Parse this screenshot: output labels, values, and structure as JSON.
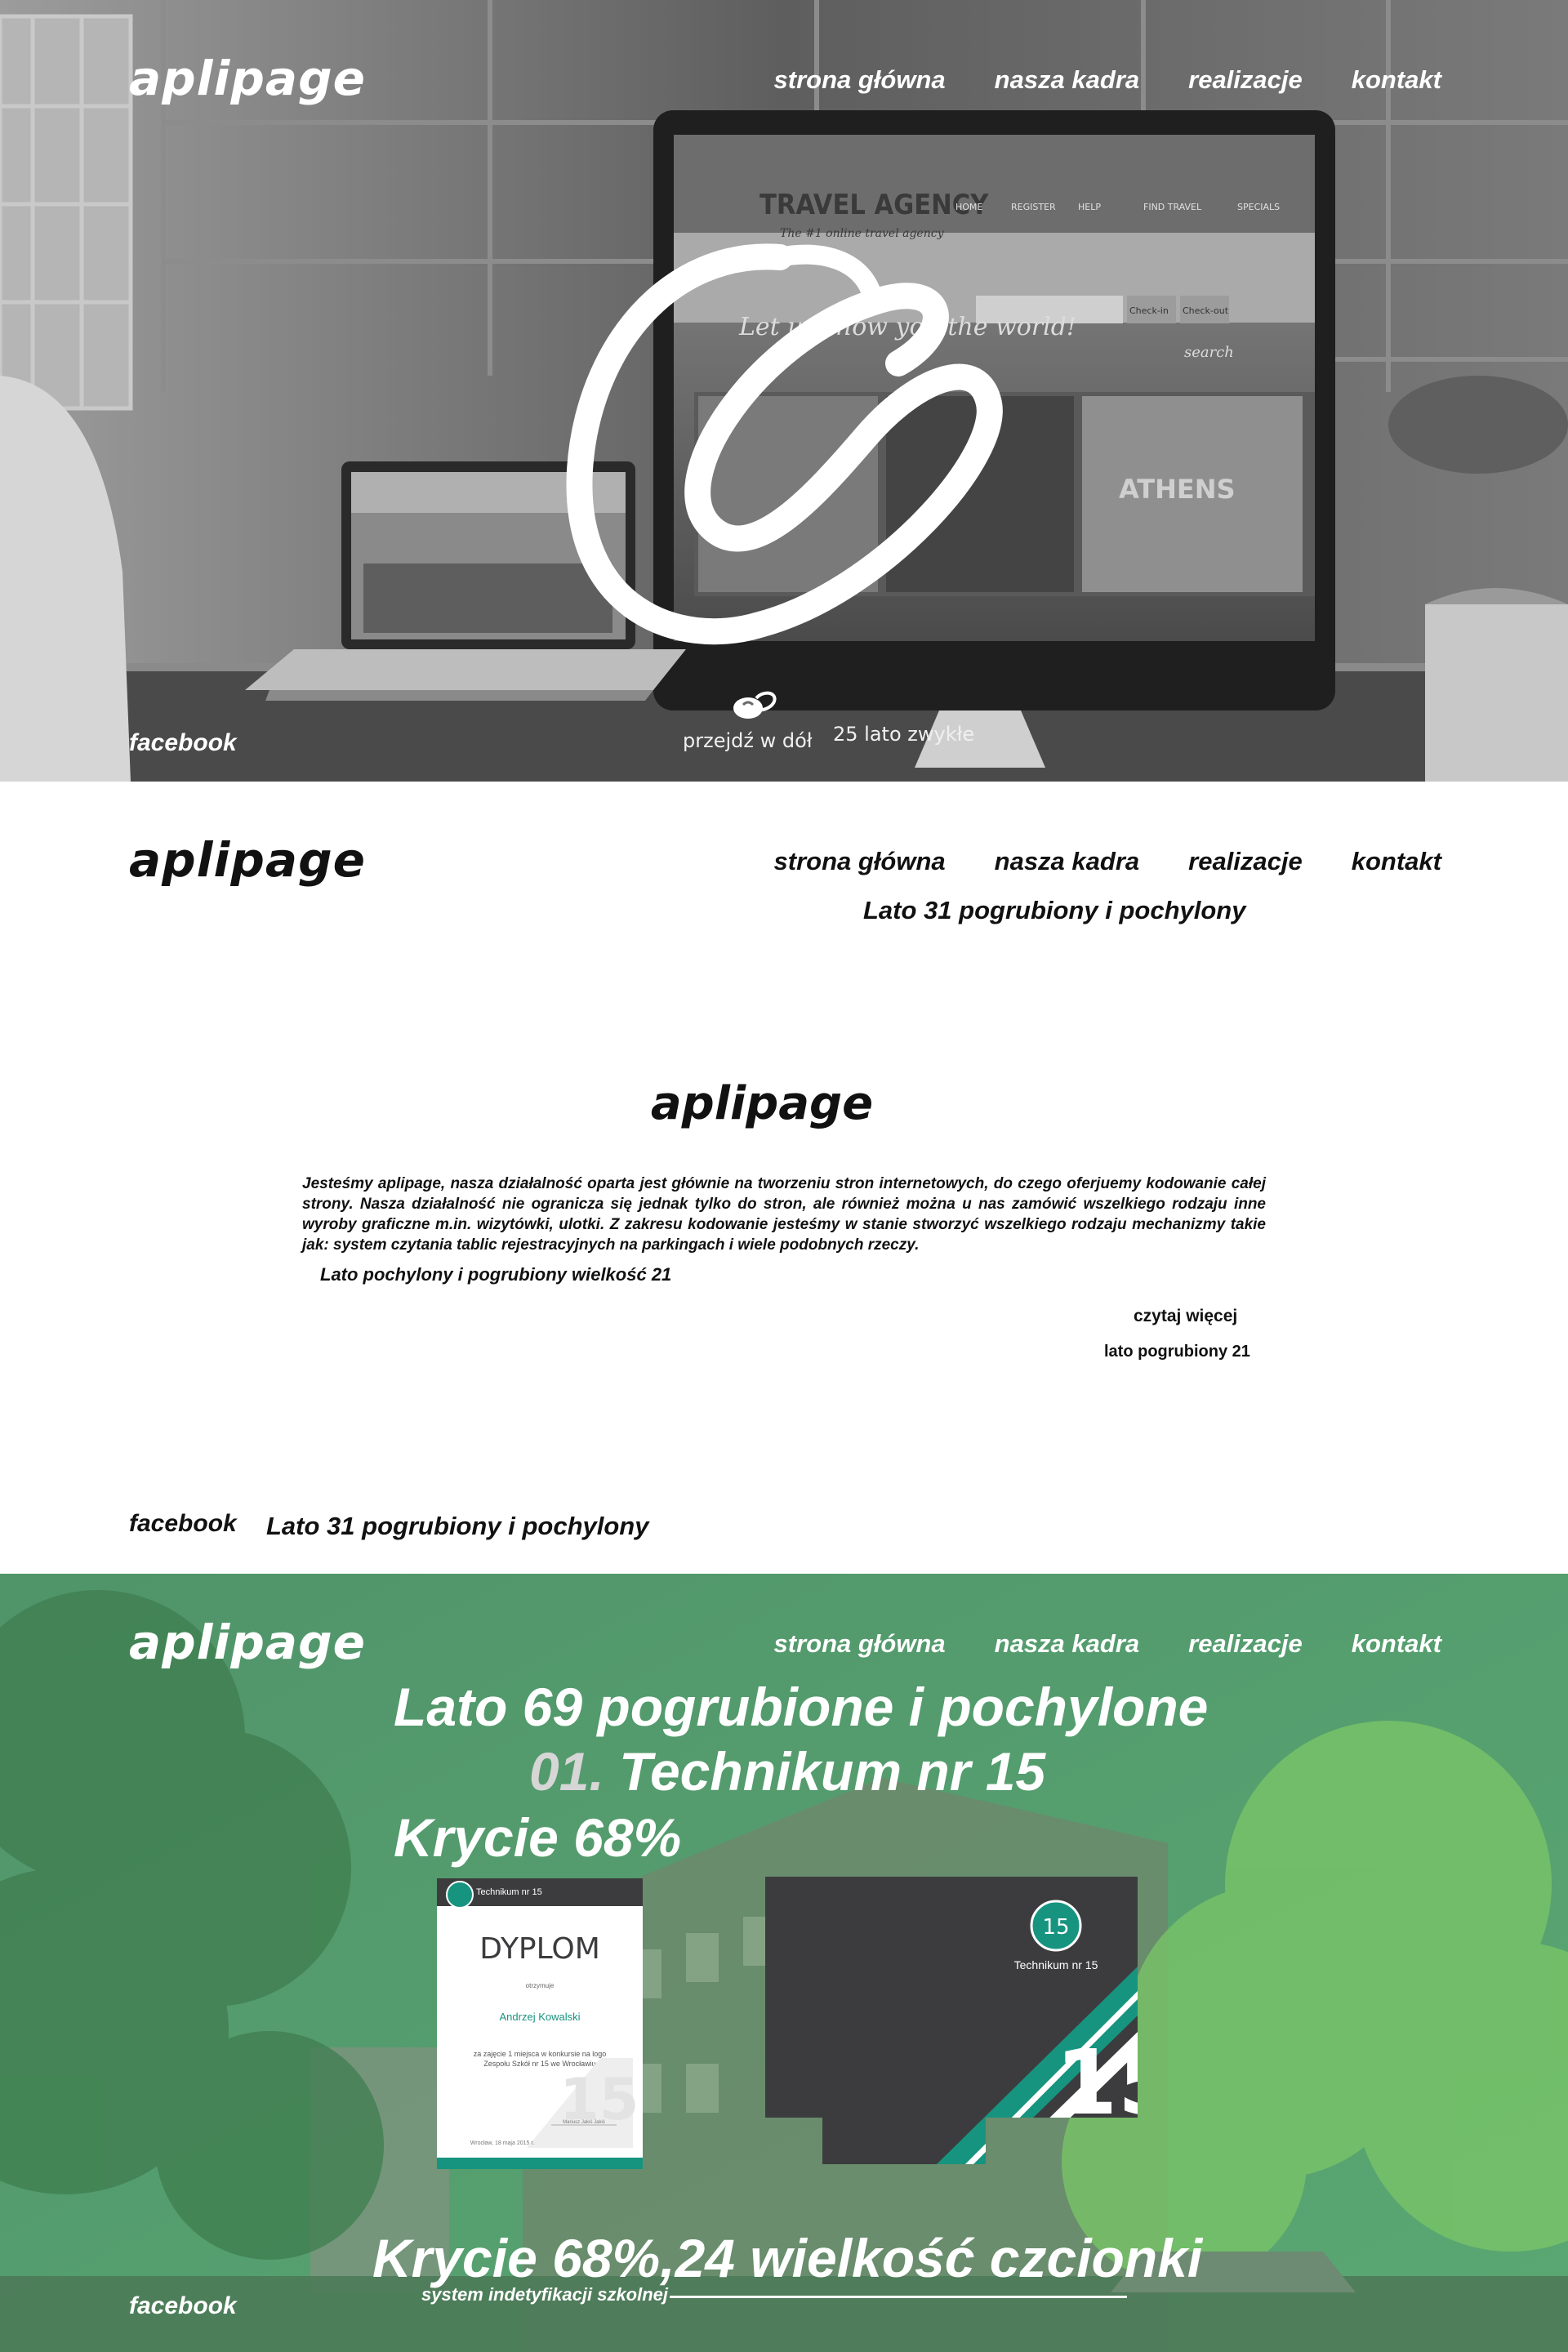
{
  "hero": {
    "logo": "aplipage",
    "nav": [
      "strona główna",
      "nasza kadra",
      "realizacje",
      "kontakt"
    ],
    "facebook": "facebook",
    "scroll_label": "przejdź w dół",
    "scroll_note": "25 lato zwykłe",
    "screen_texts": {
      "agency": "TRAVEL AGENCY",
      "agency_sub": "The #1 online travel agency",
      "slogan": "Let us show you the world!",
      "city": "ATHENS",
      "search": "search",
      "checkin": "Check-in",
      "checkout": "Check-out",
      "menu": [
        "HOME",
        "REGISTER",
        "HELP",
        "FIND TRAVEL",
        "SPECIALS"
      ]
    }
  },
  "about": {
    "logo": "aplipage",
    "nav": [
      "strona główna",
      "nasza kadra",
      "realizacje",
      "kontakt"
    ],
    "sub_nav": "Lato 31 pogrubiony i pochylony",
    "title": "aplipage",
    "text": "Jesteśmy aplipage, nasza działalność oparta jest głównie na tworzeniu stron internetowych, do czego oferjuemy kodowanie całej strony. Nasza działalność nie ogranicza się jednak tylko do stron, ale również można u nas zamówić wszelkiego rodzaju inne wyroby graficzne m.in. wizytówki, ulotki. Z zakresu kodowanie jesteśmy w stanie stworzyć wszelkiego rodzaju mechanizmy takie jak: system czytania tablic rejestracyjnych na parkingach i wiele podobnych rzeczy.",
    "caption": "Lato pochylony i pogrubiony wielkość 21",
    "read_more": "czytaj więcej",
    "read_more_note": "lato pogrubiony 21",
    "facebook": "facebook",
    "footer_note": "Lato 31 pogrubiony i pochylony"
  },
  "project": {
    "logo": "aplipage",
    "nav": [
      "strona główna",
      "nasza kadra",
      "realizacje",
      "kontakt"
    ],
    "heading": "Lato 69 pogrubione i pochylone",
    "number": "01.",
    "name": "Technikum nr 15",
    "coverage": "Krycie 68%",
    "bottom": "Krycie 68%,24 wielkość czcionki",
    "tagline": "system indetyfikacji szkolnej",
    "facebook": "facebook",
    "diploma": {
      "school": "Technikum nr 15",
      "title": "DYPLOM",
      "awarded": "otrzymuje",
      "name": "Andrzej Kowalski",
      "reason_1": "za zajęcie 1 miejsca w konkursie na logo",
      "reason_2": "Zespołu Szkół nr 15 we Wrocławiu",
      "sign": "Mariusz Jakiś Jakiś",
      "date": "Wrocław, 18 maja 2015 r."
    },
    "folder": {
      "school": "Technikum nr 15",
      "badge": "15"
    },
    "colors": {
      "teal": "#17947f",
      "dark": "#3c3c3e",
      "green_overlay": "#3f9a67"
    }
  }
}
